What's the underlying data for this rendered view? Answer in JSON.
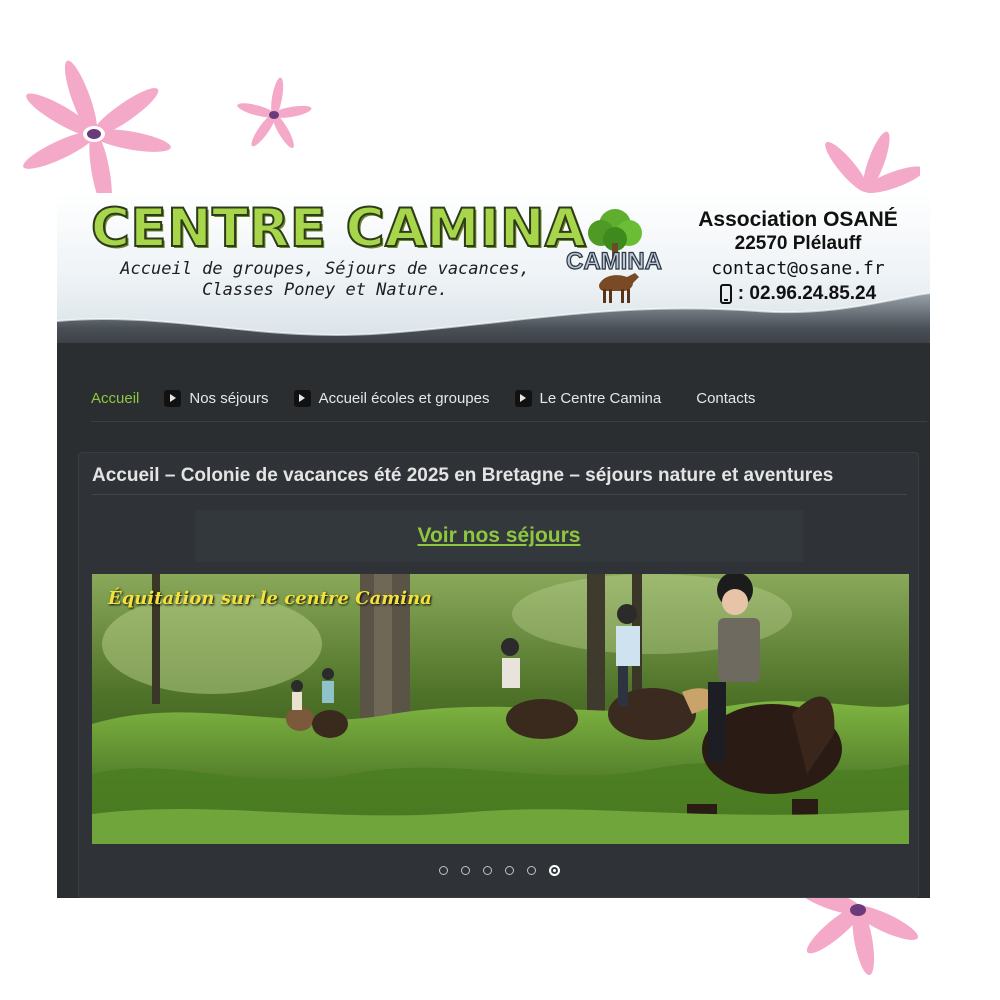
{
  "header": {
    "brand_title": "CENTRE CAMINA",
    "tagline_line1": "Accueil de groupes, Séjours de vacances,",
    "tagline_line2": "Classes Poney et Nature.",
    "logo_text": "CAMINA",
    "contact": {
      "organisation": "Association OSANÉ",
      "postcode_city": "22570 Plélauff",
      "email": "contact@osane.fr",
      "phone": ": 02.96.24.85.24"
    }
  },
  "nav": {
    "items": [
      {
        "label": "Accueil",
        "active": true,
        "has_arrow": false
      },
      {
        "label": "Nos séjours",
        "active": false,
        "has_arrow": true
      },
      {
        "label": "Accueil écoles et groupes",
        "active": false,
        "has_arrow": true
      },
      {
        "label": "Le Centre Camina",
        "active": false,
        "has_arrow": true
      },
      {
        "label": "Contacts",
        "active": false,
        "has_arrow": false
      }
    ]
  },
  "main": {
    "page_title": "Accueil – Colonie de vacances été 2025 en Bretagne – séjours nature et aventures",
    "cta_label": "Voir nos séjours",
    "slider": {
      "caption": "Équitation sur le centre Camina",
      "slide_count": 6,
      "active_index": 5
    }
  },
  "colors": {
    "accent": "#8ec63f",
    "background": "#2b2e31",
    "flower": "#f4a9c9",
    "flower_center": "#6b3a7a"
  }
}
